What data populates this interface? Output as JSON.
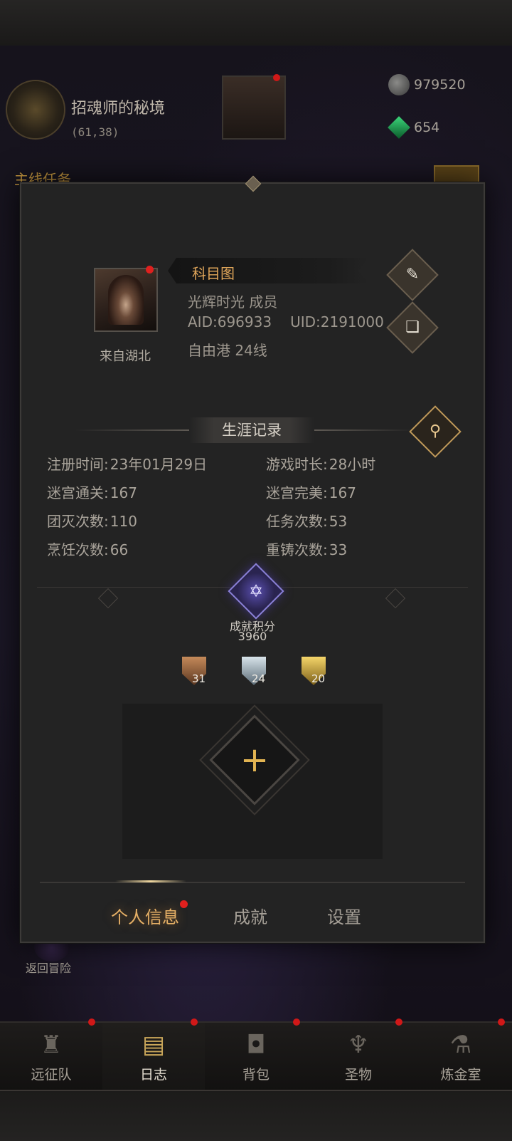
{
  "background": {
    "location_name": "招魂师的秘境",
    "location_coords": "(61,38)",
    "resources": {
      "stone": "979520",
      "gem": "654"
    },
    "quest_tab": "主线任务",
    "return_label": "返回冒险"
  },
  "profile": {
    "name": "科目图",
    "guild": "光辉时光 成员",
    "aid": "AID:696933",
    "uid": "UID:2191000",
    "server": "自由港 24线",
    "origin": "来自湖北"
  },
  "career": {
    "title": "生涯记录",
    "stats": [
      {
        "label": "注册时间:",
        "value": "23年01月29日"
      },
      {
        "label": "游戏时长:",
        "value": "28小时"
      },
      {
        "label": "迷宫通关:",
        "value": "167"
      },
      {
        "label": "迷宫完美:",
        "value": "167"
      },
      {
        "label": "团灭次数:",
        "value": "110"
      },
      {
        "label": "任务次数:",
        "value": "53"
      },
      {
        "label": "烹饪次数:",
        "value": "66"
      },
      {
        "label": "重铸次数:",
        "value": "33"
      }
    ]
  },
  "achievement": {
    "label": "成就积分",
    "score": "3960",
    "badges": [
      {
        "tier": "bronze",
        "count": "31"
      },
      {
        "tier": "silver",
        "count": "24"
      },
      {
        "tier": "gold",
        "count": "20"
      }
    ]
  },
  "tabs": [
    {
      "label": "个人信息",
      "active": true
    },
    {
      "label": "成就",
      "active": false
    },
    {
      "label": "设置",
      "active": false
    }
  ],
  "bottom_nav": [
    {
      "label": "远征队",
      "icon": "helmet-icon"
    },
    {
      "label": "日志",
      "icon": "journal-icon"
    },
    {
      "label": "背包",
      "icon": "backpack-icon"
    },
    {
      "label": "圣物",
      "icon": "relic-icon"
    },
    {
      "label": "炼金室",
      "icon": "alchemy-icon"
    }
  ],
  "colors": {
    "accent": "#e6b066",
    "notification": "#e0201e"
  }
}
